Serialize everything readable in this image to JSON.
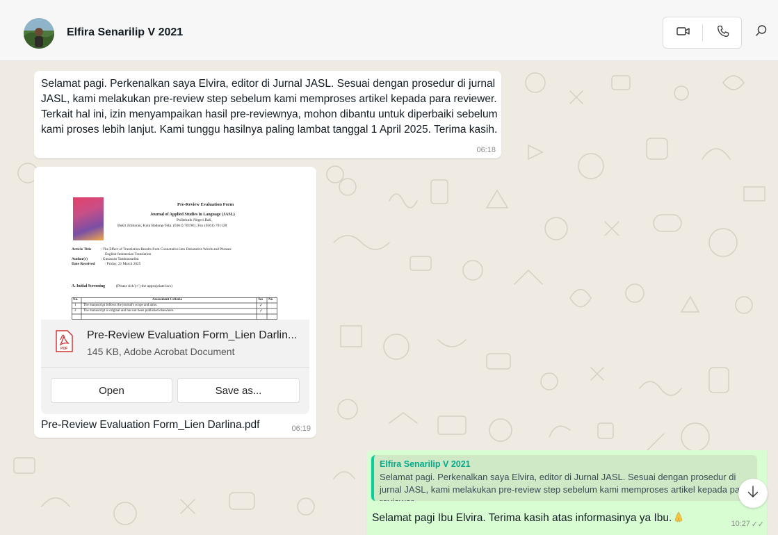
{
  "header": {
    "contact_name": "Elfira Senarilip V 2021",
    "video_call_icon": "video-camera-icon",
    "voice_call_icon": "phone-icon",
    "search_icon": "search-icon"
  },
  "messages": [
    {
      "direction": "incoming",
      "text": "Selamat pagi. Perkenalkan saya Elvira, editor di Jurnal JASL. Sesuai dengan prosedur di jurnal JASL, kami melakukan pre-review step sebelum kami memproses artikel kepada para reviewer. Terkait hal ini, izin menyampaikan hasil pre-reviewnya, mohon dibantu untuk diperbaiki sebelum kami proses lebih lanjut. Kami tunggu hasilnya paling lambat tanggal 1 April 2025. Terima kasih.",
      "time": "06:18"
    },
    {
      "direction": "incoming",
      "type": "document",
      "preview": {
        "title": "Pre-Review Evaluation Form",
        "journal": "Journal of Applied Studies in Language (JASL)",
        "institution": "Politeknik Negeri Bali,",
        "address": "Bukit Jimbaran, Kuta Badung-Telp. (0361) 701981, Fax (0361) 701128",
        "article_title_label": "Article Title",
        "article_title_value": ": The Effect of Translation Results from Connotative into Denotative Words and Phrases:",
        "article_title_value2": "English-Indonesian Translation",
        "authors_label": "Author(s)",
        "authors_value": ": Gunawan Tambunsaribu",
        "date_label": "Date Received",
        "date_value": ": Friday, 21 March 2025",
        "section_heading": "A. Initial Screening",
        "section_note": "(Please tick (✓) the appropriate box)",
        "table_headers": [
          "No.",
          "Assessment Criteria",
          "Yes",
          "No"
        ],
        "table_rows": [
          [
            "1",
            "The manuscript follows the journal's scope and aims.",
            "✓",
            ""
          ],
          [
            "2",
            "The manuscript is original and has not been published elsewhere.",
            "✓",
            ""
          ]
        ]
      },
      "file_name": "Pre-Review Evaluation Form_Lien Darlin...",
      "file_meta": "145 KB, Adobe Acrobat Document",
      "file_icon": "pdf-icon",
      "pdf_badge": "PDF",
      "open_label": "Open",
      "save_label": "Save as...",
      "caption": "Pre-Review Evaluation Form_Lien Darlina.pdf",
      "time": "06:19"
    },
    {
      "direction": "outgoing",
      "quote_author": "Elfira Senarilip V 2021",
      "quote_text": "Selamat pagi. Perkenalkan saya Elvira, editor di Jurnal JASL. Sesuai dengan prosedur di jurnal JASL, kami melakukan pre-review step sebelum kami memproses artikel kepada para reviewer.",
      "text": "Selamat pagi Ibu Elvira. Terima kasih atas informasinya ya Ibu.",
      "emoji_icon": "folded-hands-emoji",
      "time": "10:27",
      "status_icon": "double-check-icon",
      "status_glyph": "✓✓"
    }
  ],
  "scroll_down_icon": "arrow-down-icon",
  "colors": {
    "chat_background": "#efeae2",
    "incoming_bubble": "#ffffff",
    "outgoing_bubble": "#d9fdd3",
    "quote_accent": "#06cf9c",
    "pdf_red": "#d32f2f"
  }
}
